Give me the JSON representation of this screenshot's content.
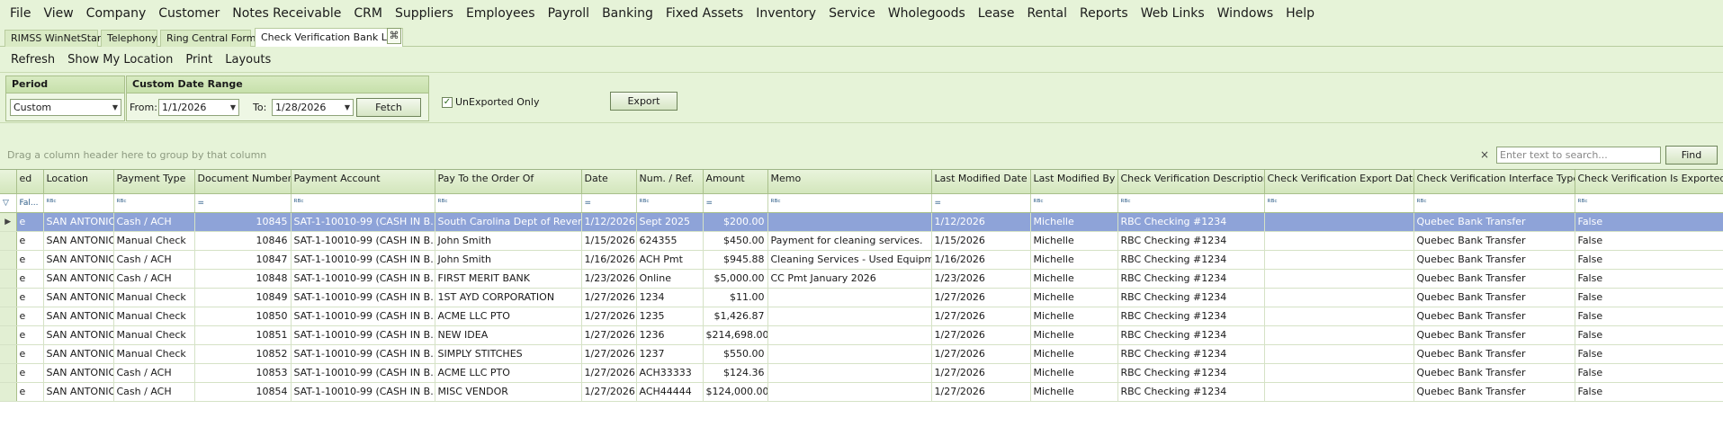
{
  "menu": [
    "File",
    "View",
    "Company",
    "Customer",
    "Notes Receivable",
    "CRM",
    "Suppliers",
    "Employees",
    "Payroll",
    "Banking",
    "Fixed Assets",
    "Inventory",
    "Service",
    "Wholegoods",
    "Lease",
    "Rental",
    "Reports",
    "Web Links",
    "Windows",
    "Help"
  ],
  "tabs": [
    "RIMSS WinNetStar",
    "Telephony",
    "Ring Central Form",
    "Check Verification Bank List"
  ],
  "tab_close_glyph": "⌘",
  "toolbar": {
    "refresh": "Refresh",
    "show_location": "Show My Location",
    "print": "Print",
    "layouts": "Layouts"
  },
  "period": {
    "title": "Period",
    "value": "Custom"
  },
  "date_range": {
    "title": "Custom Date Range",
    "from_label": "From:",
    "from_value": "1/1/2026",
    "to_label": "To:",
    "to_value": "1/28/2026",
    "fetch": "Fetch"
  },
  "unexported": {
    "label": "UnExported Only",
    "checked": true
  },
  "export_label": "Export",
  "group_hint": "Drag a column header here to group by that column",
  "search": {
    "placeholder": "Enter text to search...",
    "find": "Find",
    "clear": "×"
  },
  "columns": [
    "ed",
    "Location",
    "Payment Type",
    "Document Number",
    "Payment Account",
    "Pay To the Order Of",
    "Date",
    "Num. / Ref.",
    "Amount",
    "Memo",
    "Last Modified Date",
    "Last Modified By",
    "Check Verification Description",
    "Check Verification Export Date",
    "Check Verification Interface Type",
    "Check Verification Is Exported"
  ],
  "filter_row": [
    "Fal...",
    "ᴿᴮᶜ",
    "ᴿᴮᶜ",
    "=",
    "ᴿᴮᶜ",
    "ᴿᴮᶜ",
    "=",
    "ᴿᴮᶜ",
    "=",
    "ᴿᴮᶜ",
    "=",
    "ᴿᴮᶜ",
    "ᴿᴮᶜ",
    "ᴿᴮᶜ",
    "ᴿᴮᶜ",
    "ᴿᴮᶜ"
  ],
  "rows": [
    [
      "e",
      "SAN ANTONIO",
      "Cash / ACH",
      "10845",
      "SAT-1-10010-99 (CASH IN B...",
      "South Carolina Dept of Revenue",
      "1/12/2026",
      "Sept 2025",
      "$200.00",
      "",
      "1/12/2026",
      "Michelle",
      "RBC Checking #1234",
      "",
      "Quebec Bank Transfer",
      "False"
    ],
    [
      "e",
      "SAN ANTONIO",
      "Manual Check",
      "10846",
      "SAT-1-10010-99 (CASH IN B...",
      "John Smith",
      "1/15/2026",
      "624355",
      "$450.00",
      "Payment for cleaning services.",
      "1/15/2026",
      "Michelle",
      "RBC Checking #1234",
      "",
      "Quebec Bank Transfer",
      "False"
    ],
    [
      "e",
      "SAN ANTONIO",
      "Cash / ACH",
      "10847",
      "SAT-1-10010-99 (CASH IN B...",
      "John Smith",
      "1/16/2026",
      "ACH Pmt",
      "$945.88",
      "Cleaning Services - Used Equipment",
      "1/16/2026",
      "Michelle",
      "RBC Checking #1234",
      "",
      "Quebec Bank Transfer",
      "False"
    ],
    [
      "e",
      "SAN ANTONIO",
      "Cash / ACH",
      "10848",
      "SAT-1-10010-99 (CASH IN B...",
      "FIRST MERIT BANK",
      "1/23/2026",
      "Online",
      "$5,000.00",
      "CC Pmt January 2026",
      "1/23/2026",
      "Michelle",
      "RBC Checking #1234",
      "",
      "Quebec Bank Transfer",
      "False"
    ],
    [
      "e",
      "SAN ANTONIO",
      "Manual Check",
      "10849",
      "SAT-1-10010-99 (CASH IN B...",
      "1ST AYD CORPORATION",
      "1/27/2026",
      "1234",
      "$11.00",
      "",
      "1/27/2026",
      "Michelle",
      "RBC Checking #1234",
      "",
      "Quebec Bank Transfer",
      "False"
    ],
    [
      "e",
      "SAN ANTONIO",
      "Manual Check",
      "10850",
      "SAT-1-10010-99 (CASH IN B...",
      "ACME LLC PTO",
      "1/27/2026",
      "1235",
      "$1,426.87",
      "",
      "1/27/2026",
      "Michelle",
      "RBC Checking #1234",
      "",
      "Quebec Bank Transfer",
      "False"
    ],
    [
      "e",
      "SAN ANTONIO",
      "Manual Check",
      "10851",
      "SAT-1-10010-99 (CASH IN B...",
      "NEW IDEA",
      "1/27/2026",
      "1236",
      "$214,698.00",
      "",
      "1/27/2026",
      "Michelle",
      "RBC Checking #1234",
      "",
      "Quebec Bank Transfer",
      "False"
    ],
    [
      "e",
      "SAN ANTONIO",
      "Manual Check",
      "10852",
      "SAT-1-10010-99 (CASH IN B...",
      "SIMPLY STITCHES",
      "1/27/2026",
      "1237",
      "$550.00",
      "",
      "1/27/2026",
      "Michelle",
      "RBC Checking #1234",
      "",
      "Quebec Bank Transfer",
      "False"
    ],
    [
      "e",
      "SAN ANTONIO",
      "Cash / ACH",
      "10853",
      "SAT-1-10010-99 (CASH IN B...",
      "ACME LLC PTO",
      "1/27/2026",
      "ACH33333",
      "$124.36",
      "",
      "1/27/2026",
      "Michelle",
      "RBC Checking #1234",
      "",
      "Quebec Bank Transfer",
      "False"
    ],
    [
      "e",
      "SAN ANTONIO",
      "Cash / ACH",
      "10854",
      "SAT-1-10010-99 (CASH IN B...",
      "MISC VENDOR",
      "1/27/2026",
      "ACH44444",
      "$124,000.00",
      "",
      "1/27/2026",
      "Michelle",
      "RBC Checking #1234",
      "",
      "Quebec Bank Transfer",
      "False"
    ]
  ],
  "selected_row": 0,
  "colors": {
    "bg": "#e6f3d8",
    "selection": "#8ea3d8",
    "header": "#d3e6bc"
  }
}
